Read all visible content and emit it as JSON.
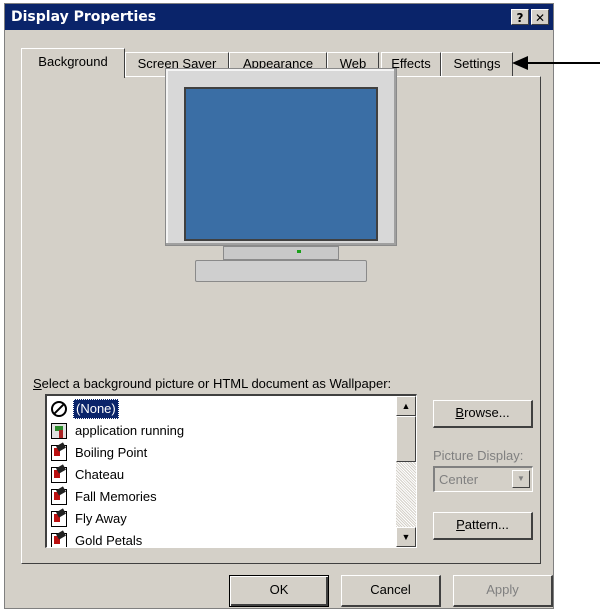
{
  "window": {
    "title": "Display Properties",
    "help_label": "?",
    "close_label": "✕"
  },
  "tabs": [
    {
      "label": "Background",
      "active": true
    },
    {
      "label": "Screen Saver"
    },
    {
      "label": "Appearance"
    },
    {
      "label": "Web"
    },
    {
      "label": "Effects"
    },
    {
      "label": "Settings"
    }
  ],
  "wallpaper": {
    "label_prefix": "S",
    "label_rest": "elect a background picture or HTML document as Wallpaper:",
    "items": [
      {
        "name": "(None)",
        "icon": "none-icon",
        "selected": true
      },
      {
        "name": "application running",
        "icon": "application-icon"
      },
      {
        "name": "Boiling Point",
        "icon": "html-document-icon"
      },
      {
        "name": "Chateau",
        "icon": "html-document-icon"
      },
      {
        "name": "Fall Memories",
        "icon": "html-document-icon"
      },
      {
        "name": "Fly Away",
        "icon": "html-document-icon"
      },
      {
        "name": "Gold Petals",
        "icon": "html-document-icon"
      }
    ]
  },
  "buttons": {
    "browse_prefix": "B",
    "browse_rest": "rowse...",
    "pattern_prefix": "P",
    "pattern_rest": "attern...",
    "ok": "OK",
    "cancel": "Cancel",
    "apply": "Apply"
  },
  "picture_display": {
    "label": "Picture Display:",
    "value": "Center"
  },
  "colors": {
    "titlebar": "#0a246a",
    "face": "#d4d0c8",
    "monitor_screen": "#3a6ea5"
  }
}
